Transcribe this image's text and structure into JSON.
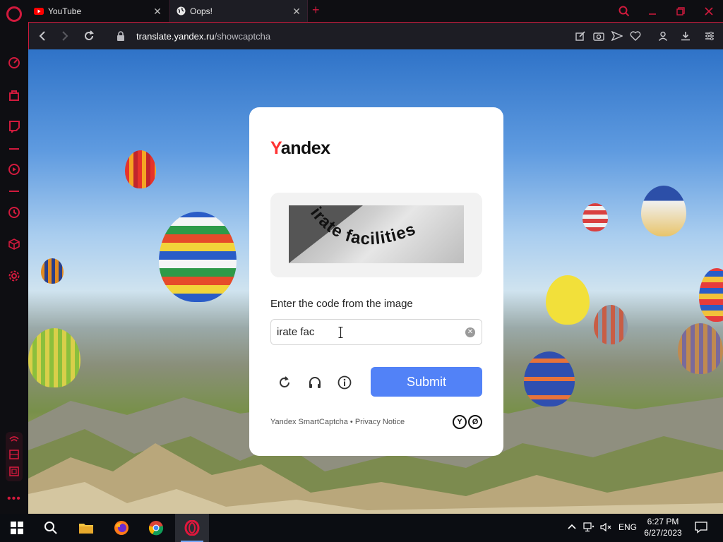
{
  "browser": {
    "tabs": [
      {
        "label": "YouTube",
        "icon": "youtube-icon"
      },
      {
        "label": "Oops!",
        "icon": "globe-icon"
      }
    ],
    "url": {
      "host": "translate.yandex.ru",
      "path": "/showcaptcha"
    }
  },
  "captcha": {
    "brand_first": "Y",
    "brand_rest": "andex",
    "image_text": "irate facilities",
    "prompt": "Enter the code from the image",
    "input_value": "irate fac",
    "submit_label": "Submit",
    "footer": "Yandex SmartCaptcha • Privacy Notice",
    "footer_logo_1": "Y",
    "footer_logo_2": "Ø"
  },
  "taskbar": {
    "lang": "ENG",
    "time": "6:27 PM",
    "date": "6/27/2023"
  },
  "colors": {
    "opera_red": "#d11a3d",
    "submit_blue": "#5282f7",
    "yandex_red": "#ff3333"
  }
}
